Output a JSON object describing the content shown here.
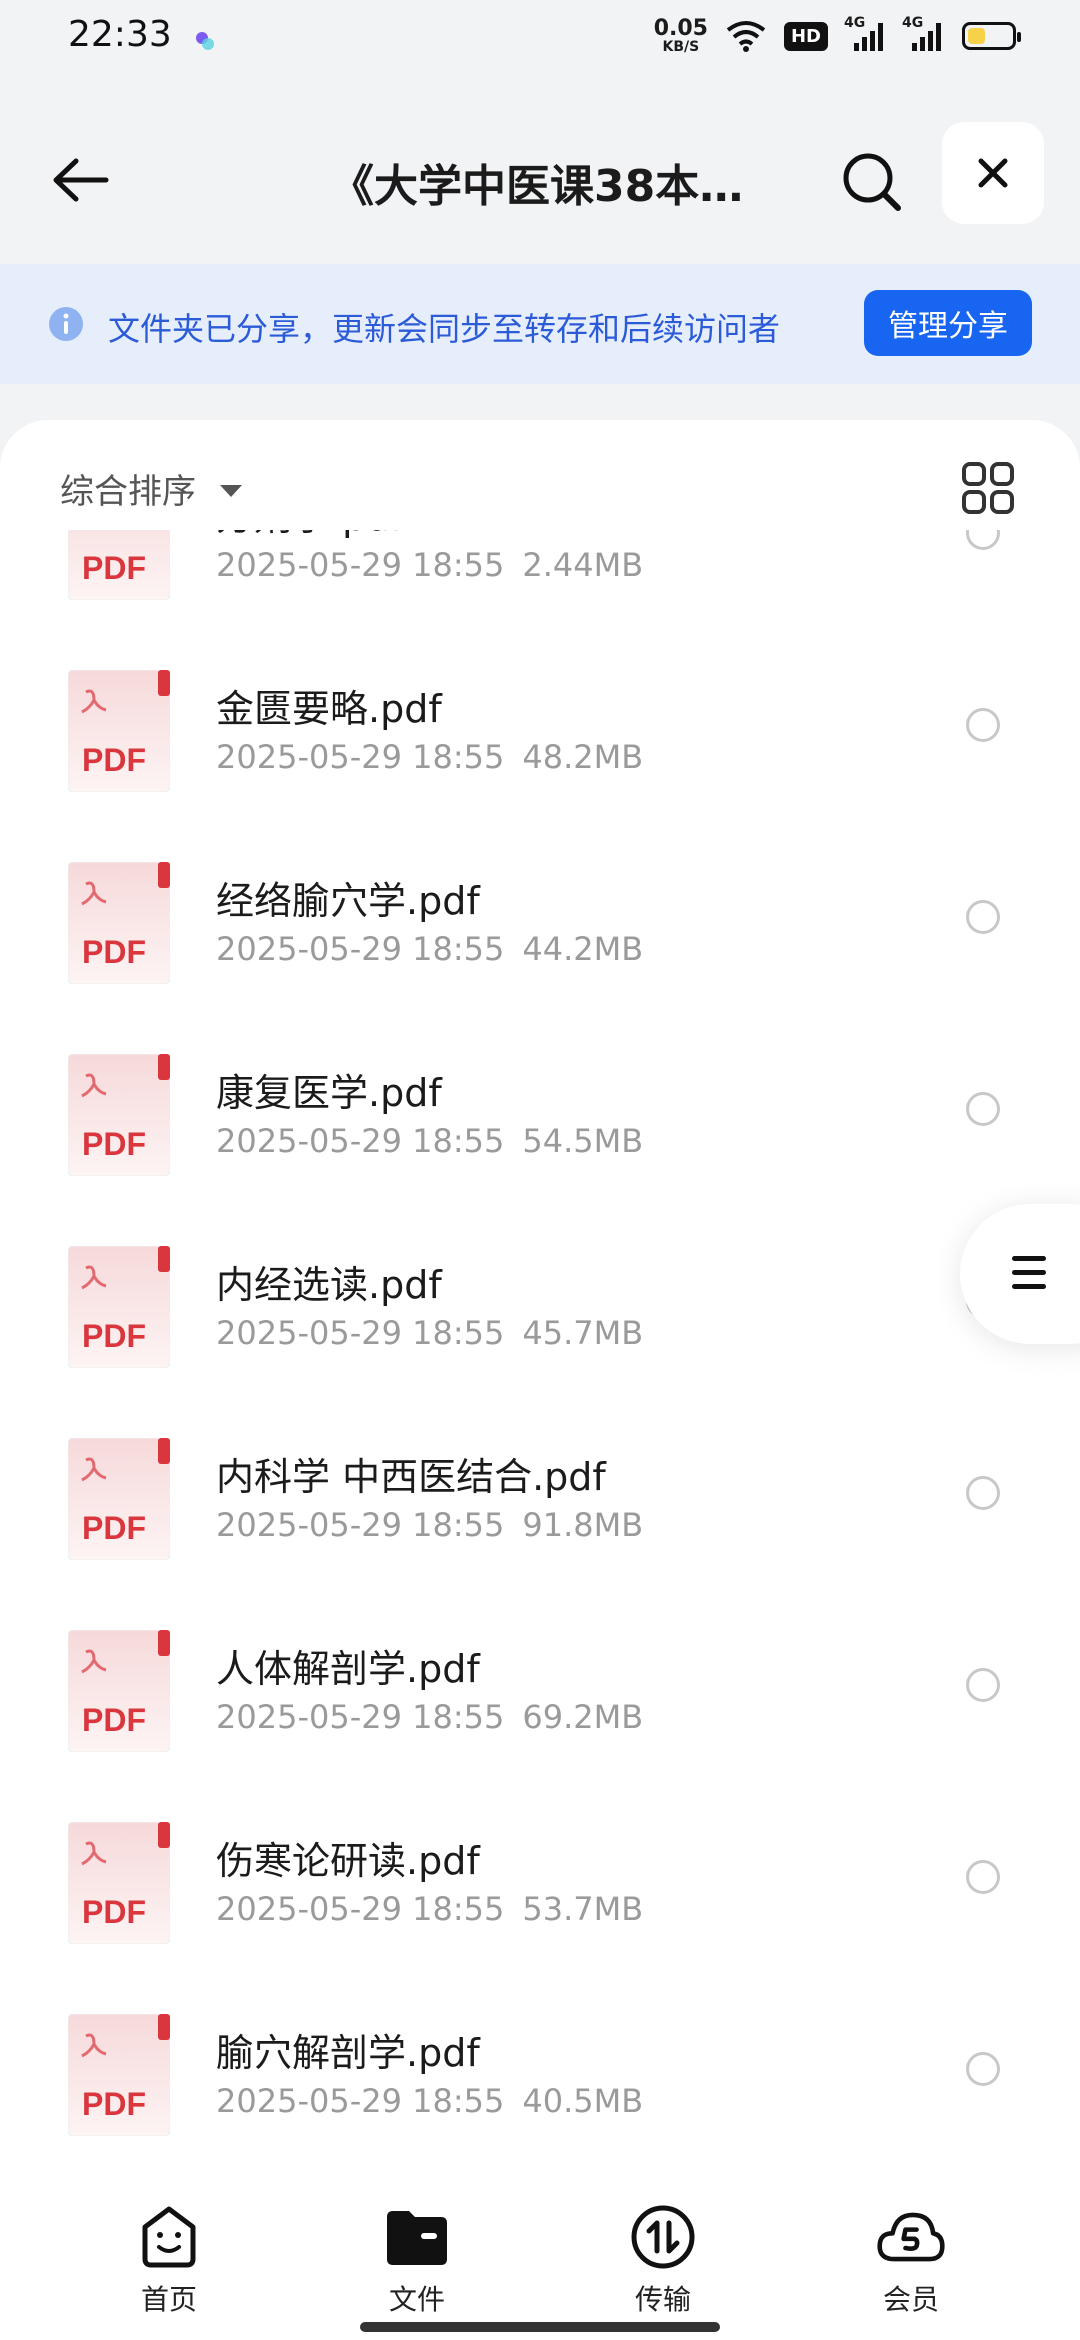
{
  "status_bar": {
    "time": "22:33",
    "net_speed_value": "0.05",
    "net_speed_unit": "KB/S",
    "hd_label": "HD",
    "signal_1_label": "4G",
    "signal_2_label": "4G",
    "battery_level": 0.4,
    "icons": [
      "wifi-icon",
      "hd-icon",
      "signal-icon",
      "signal-icon",
      "battery-icon"
    ]
  },
  "header": {
    "title": "《大学中医课38本…",
    "icons": [
      "back-arrow-icon",
      "search-icon",
      "close-icon"
    ]
  },
  "banner": {
    "text": "文件夹已分享，更新会同步至转存和后续访问者",
    "button_label": "管理分享",
    "icon": "info-icon"
  },
  "toolbar": {
    "sort_label": "综合排序",
    "sort_icon": "caret-down-icon",
    "view_icon": "grid-view-icon"
  },
  "files": [
    {
      "name": "方剂学.pdf",
      "date": "2025-05-29 18:55",
      "size": "2.44MB",
      "type_label": "PDF"
    },
    {
      "name": "金匮要略.pdf",
      "date": "2025-05-29 18:55",
      "size": "48.2MB",
      "type_label": "PDF"
    },
    {
      "name": "经络腧穴学.pdf",
      "date": "2025-05-29 18:55",
      "size": "44.2MB",
      "type_label": "PDF"
    },
    {
      "name": "康复医学.pdf",
      "date": "2025-05-29 18:55",
      "size": "54.5MB",
      "type_label": "PDF"
    },
    {
      "name": "内经选读.pdf",
      "date": "2025-05-29 18:55",
      "size": "45.7MB",
      "type_label": "PDF"
    },
    {
      "name": "内科学 中西医结合.pdf",
      "date": "2025-05-29 18:55",
      "size": "91.8MB",
      "type_label": "PDF"
    },
    {
      "name": "人体解剖学.pdf",
      "date": "2025-05-29 18:55",
      "size": "69.2MB",
      "type_label": "PDF"
    },
    {
      "name": "伤寒论研读.pdf",
      "date": "2025-05-29 18:55",
      "size": "53.7MB",
      "type_label": "PDF"
    },
    {
      "name": "腧穴解剖学.pdf",
      "date": "2025-05-29 18:55",
      "size": "40.5MB",
      "type_label": "PDF"
    }
  ],
  "tabs": [
    {
      "label": "首页",
      "icon": "home-face-icon"
    },
    {
      "label": "文件",
      "icon": "folder-icon"
    },
    {
      "label": "传输",
      "icon": "transfer-icon"
    },
    {
      "label": "会员",
      "icon": "vip-cloud-icon"
    }
  ],
  "colors": {
    "accent": "#1765f0",
    "banner_bg": "#e7eefb",
    "banner_text": "#2c5bd8",
    "pdf_red": "#d9363e"
  }
}
